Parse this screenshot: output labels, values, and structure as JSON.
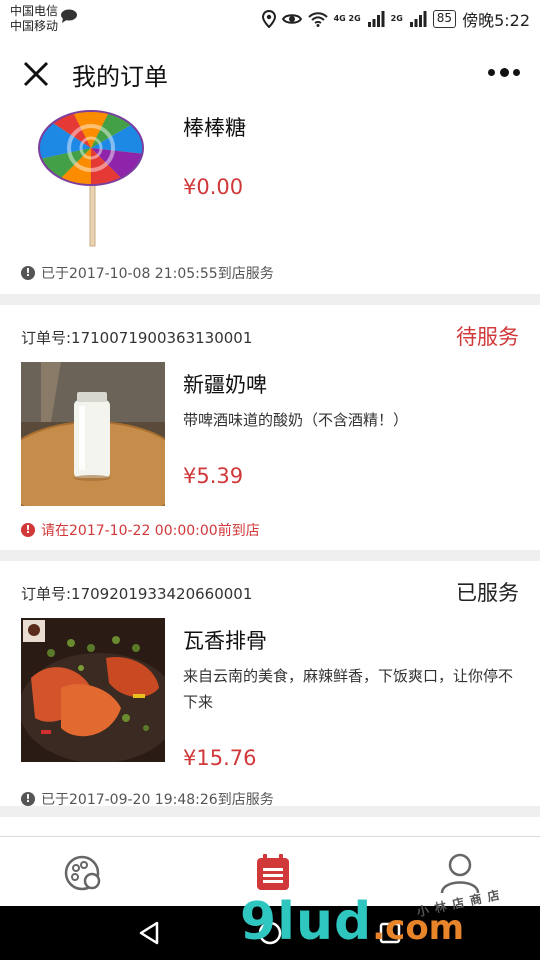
{
  "status_bar": {
    "carrier_1": "中国电信",
    "carrier_2": "中国移动",
    "net_1": "4G 2G",
    "net_2": "2G",
    "battery": "85",
    "time": "傍晚5:22"
  },
  "header": {
    "title": "我的订单"
  },
  "orders": [
    {
      "item_name": "棒棒糖",
      "price": "¥0.00",
      "note": "已于2017-10-08 21:05:55到店服务"
    },
    {
      "order_no": "订单号:1710071900363130001",
      "status": "待服务",
      "item_name": "新疆奶啤",
      "description": "带啤酒味道的酸奶（不含酒精！）",
      "price": "¥5.39",
      "note": "请在2017-10-22 00:00:00前到店"
    },
    {
      "order_no": "订单号:1709201933420660001",
      "status": "已服务",
      "item_name": "瓦香排骨",
      "description": "来自云南的美食，麻辣鲜香，下饭爽口，让你停不下来",
      "price": "¥15.76",
      "note": "已于2017-09-20 19:48:26到店服务"
    }
  ],
  "colors": {
    "accent_red": "#d0383a",
    "background": "#efefef"
  },
  "watermark": {
    "main": "9lud",
    "suffix": ".com",
    "small": "小林店商店"
  }
}
